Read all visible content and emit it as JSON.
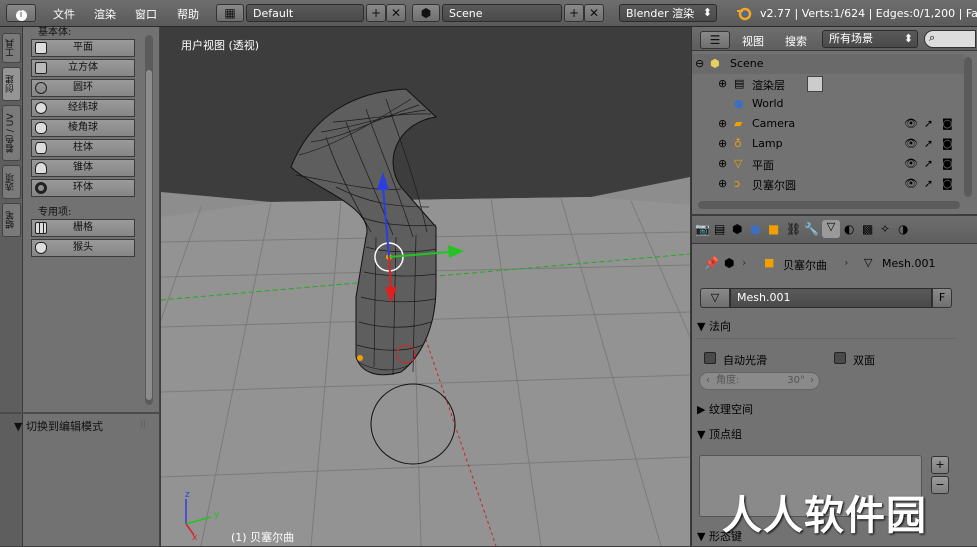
{
  "topbar": {
    "menus": [
      "文件",
      "渲染",
      "窗口",
      "帮助"
    ],
    "layout_value": "Default",
    "scene_value": "Scene",
    "render_engine": "Blender 渲染",
    "stats": "v2.77 | Verts:1/624 | Edges:0/1,200 | Faces"
  },
  "left_tabs": [
    "工具",
    "创建",
    "着色 / UV",
    "选项",
    "蜡笔"
  ],
  "left_panel": {
    "section_title": "基本体:",
    "primitives": [
      "平面",
      "立方体",
      "圆环",
      "经纬球",
      "棱角球",
      "柱体",
      "锥体",
      "环体"
    ],
    "special_title": "专用项:",
    "special": [
      "栅格",
      "猴头"
    ],
    "operator_panel": "▼ 切换到编辑模式"
  },
  "viewport": {
    "title": "用户视图 (透视)",
    "object_label": "(1) 贝塞尔曲",
    "axis_labels": [
      "z",
      "y",
      "x"
    ]
  },
  "outliner": {
    "view_menu": "视图",
    "search_menu": "搜索",
    "filter_value": "所有场景",
    "items": [
      {
        "label": "Scene",
        "level": 0
      },
      {
        "label": "渲染层",
        "level": 1
      },
      {
        "label": "World",
        "level": 1
      },
      {
        "label": "Camera",
        "level": 1
      },
      {
        "label": "Lamp",
        "level": 1
      },
      {
        "label": "平面",
        "level": 1
      },
      {
        "label": "贝塞尔圆",
        "level": 1
      }
    ]
  },
  "properties": {
    "breadcrumb_object": "贝塞尔曲",
    "breadcrumb_mesh": "Mesh.001",
    "datablock_name": "Mesh.001",
    "fake_user": "F",
    "panel_normals": "▼ 法向",
    "auto_smooth": "自动光滑",
    "double_sided": "双面",
    "angle_label": "角度:",
    "angle_value": "30°",
    "panel_texture_space": "▶ 纹理空间",
    "panel_vertex_groups": "▼ 顶点组",
    "panel_shape_keys": "▼ 形态键"
  },
  "watermark": "人人软件园",
  "colors": {
    "panel_bg": "#727272",
    "viewport_bg": "#3d3d3d",
    "axis_z": "#2b3fe0",
    "axis_y": "#22c322",
    "axis_x": "#e02020"
  }
}
